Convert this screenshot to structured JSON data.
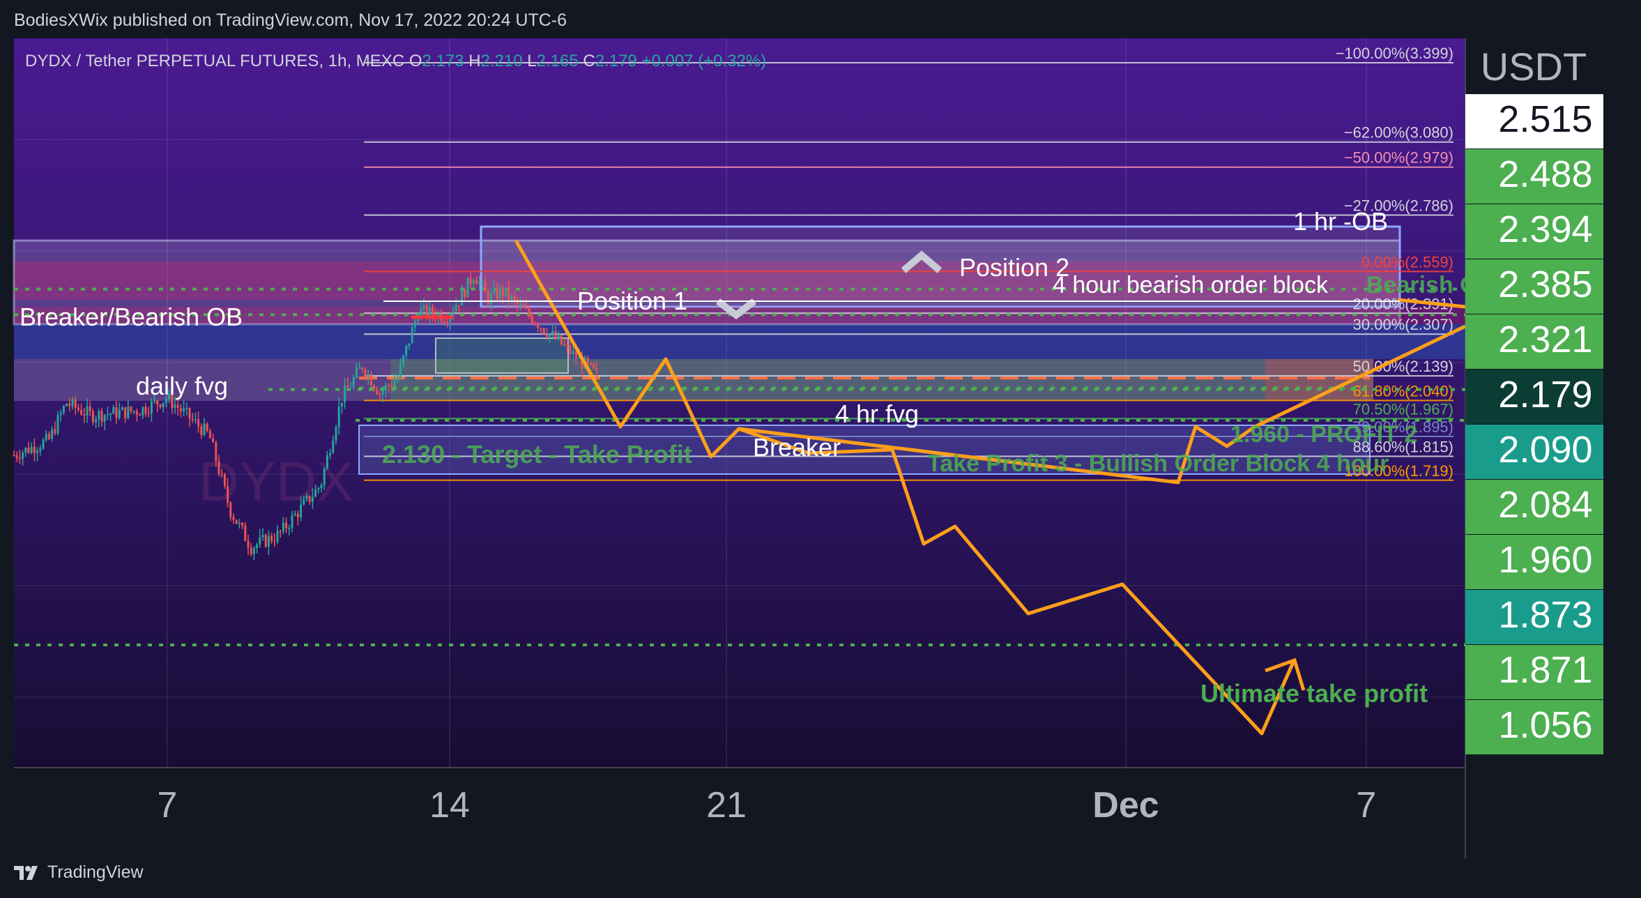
{
  "header": {
    "published": "BodiesXWix published on TradingView.com, Nov 17, 2022 20:24 UTC-6"
  },
  "footer": {
    "brand": "TradingView"
  },
  "chart_data": {
    "type": "candlestick",
    "symbol_line": {
      "symbol": "DYDX / Tether PERPETUAL FUTURES, 1h, MEXC",
      "o": "2.173",
      "h": "2.210",
      "l": "2.165",
      "c": "2.179",
      "change": "+0.007 (+0.32%)"
    },
    "currency": "USDT",
    "x_axis": {
      "ticks": [
        "7",
        "14",
        "21",
        "Dec",
        "7"
      ]
    },
    "price_axis": {
      "ylim": [
        0.95,
        3.5
      ],
      "labels": [
        {
          "value": "2.515",
          "bg": "#ffffff",
          "fg": "#131722"
        },
        {
          "value": "2.488",
          "bg": "#4caf50",
          "fg": "#ffffff"
        },
        {
          "value": "2.394",
          "bg": "#4caf50",
          "fg": "#ffffff"
        },
        {
          "value": "2.385",
          "bg": "#4caf50",
          "fg": "#ffffff"
        },
        {
          "value": "2.321",
          "bg": "#4caf50",
          "fg": "#ffffff"
        },
        {
          "value": "2.179",
          "bg": "#0b3d35",
          "fg": "#ffffff"
        },
        {
          "value": "2.090",
          "bg": "#1a9c8c",
          "fg": "#ffffff"
        },
        {
          "value": "2.084",
          "bg": "#4caf50",
          "fg": "#ffffff"
        },
        {
          "value": "1.960",
          "bg": "#4caf50",
          "fg": "#ffffff"
        },
        {
          "value": "1.873",
          "bg": "#1a9c8c",
          "fg": "#ffffff"
        },
        {
          "value": "1.871",
          "bg": "#4caf50",
          "fg": "#ffffff"
        },
        {
          "value": "1.056",
          "bg": "#4caf50",
          "fg": "#ffffff"
        }
      ]
    },
    "fib_levels": [
      {
        "label": "−100.00%(3.399)",
        "price": 3.399,
        "color": "#d1d4dc"
      },
      {
        "label": "−62.00%(3.080)",
        "price": 3.08,
        "color": "#d1d4dc"
      },
      {
        "label": "−50.00%(2.979)",
        "price": 2.979,
        "color": "#f48fb1"
      },
      {
        "label": "−27.00%(2.786)",
        "price": 2.786,
        "color": "#d1d4dc"
      },
      {
        "label": "0.00%(2.559)",
        "price": 2.559,
        "color": "#f44336"
      },
      {
        "label": "20.00%(2.391)",
        "price": 2.391,
        "color": "#d1d4dc"
      },
      {
        "label": "30.00%(2.307)",
        "price": 2.307,
        "color": "#d1d4dc"
      },
      {
        "label": "50.00%(2.139)",
        "price": 2.139,
        "color": "#d1d4dc"
      },
      {
        "label": "61.80%(2.040)",
        "price": 2.04,
        "color": "#ff9800"
      },
      {
        "label": "70.50%(1.967)",
        "price": 1.967,
        "color": "#4caf50"
      },
      {
        "label": "79.00%(1.895)",
        "price": 1.895,
        "color": "#7986cb"
      },
      {
        "label": "88.60%(1.815)",
        "price": 1.815,
        "color": "#d1d4dc"
      },
      {
        "label": "100.00%(1.719)",
        "price": 1.719,
        "color": "#ff9800"
      }
    ],
    "annotations": [
      {
        "text": "Breaker/Bearish OB",
        "color": "#ffffff"
      },
      {
        "text": "daily fvg",
        "color": "#ffffff"
      },
      {
        "text": "Position 1",
        "color": "#ffffff"
      },
      {
        "text": "Position 2",
        "color": "#ffffff"
      },
      {
        "text": "1 hr -OB",
        "color": "#ffffff"
      },
      {
        "text": "4 hour bearish order block",
        "color": "#ffffff"
      },
      {
        "text": "Bearish OB",
        "color": "#4caf50"
      },
      {
        "text": "4 hr fvg",
        "color": "#ffffff"
      },
      {
        "text": "Breaker",
        "color": "#ffffff"
      },
      {
        "text": "2.130 - Target - Take Profit",
        "color": "#4caf50"
      },
      {
        "text": "1.960 - PROFIT 2",
        "color": "#4caf50"
      },
      {
        "text": "Take Profit 3 - Bullish Order Block 4 hour",
        "color": "#4caf50"
      },
      {
        "text": "Ultimate take profit",
        "color": "#4caf50"
      }
    ],
    "watermark": "DYDX"
  }
}
